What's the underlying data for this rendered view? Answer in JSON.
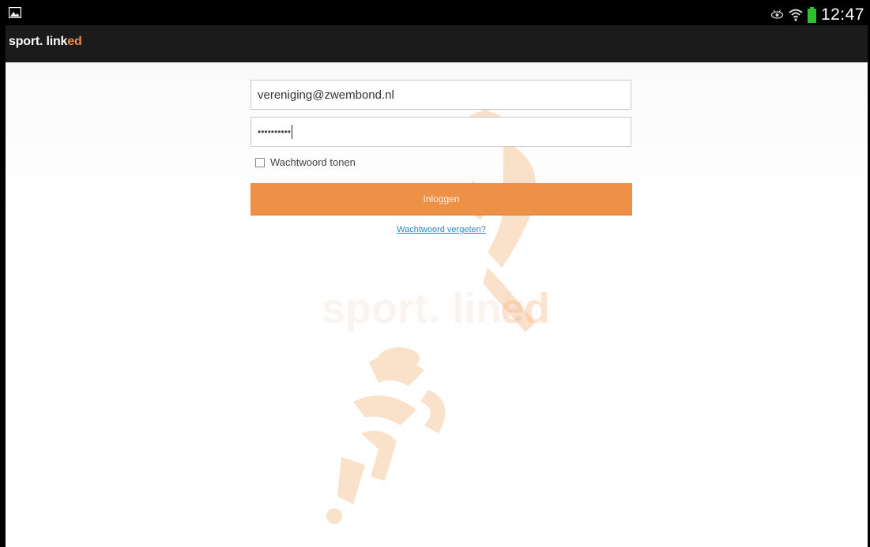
{
  "status_bar": {
    "time": "12:47",
    "icons": [
      "gallery-icon",
      "eye-icon",
      "wifi-icon",
      "battery-icon"
    ]
  },
  "app_bar": {
    "logo_main": "sport. link",
    "logo_accent": "ed"
  },
  "login_form": {
    "email_value": "vereniging@zwembond.nl",
    "password_masked": "••••••••••",
    "show_password_label": "Wachtwoord tonen",
    "show_password_checked": false,
    "login_button_label": "Inloggen",
    "forgot_password_label": "Wachtwoord vergeten?"
  },
  "background": {
    "watermark_main": "sport. link",
    "watermark_accent": "ed"
  },
  "colors": {
    "accent": "#ec9146",
    "link": "#2a88c3",
    "status_bar": "#000000",
    "action_bar": "#1b1b1b"
  }
}
